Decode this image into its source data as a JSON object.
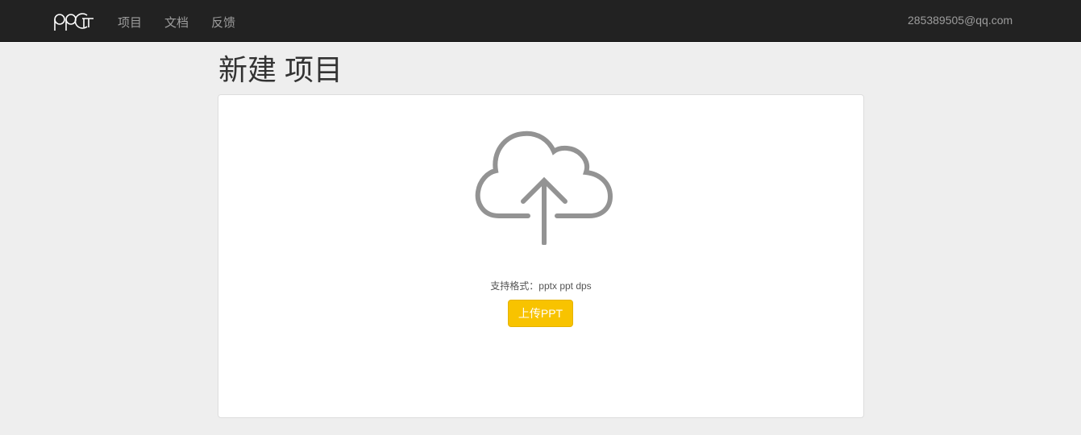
{
  "nav": {
    "logo_text": "ppcft",
    "items": [
      {
        "label": "项目"
      },
      {
        "label": "文档"
      },
      {
        "label": "反馈"
      }
    ],
    "user": "285389505@qq.com"
  },
  "page": {
    "title": "新建 项目",
    "formats_hint": "支持格式：pptx ppt dps",
    "upload_button": "上传PPT"
  },
  "colors": {
    "accent": "#f8c300",
    "navbar": "#222222",
    "icon": "#939393"
  }
}
